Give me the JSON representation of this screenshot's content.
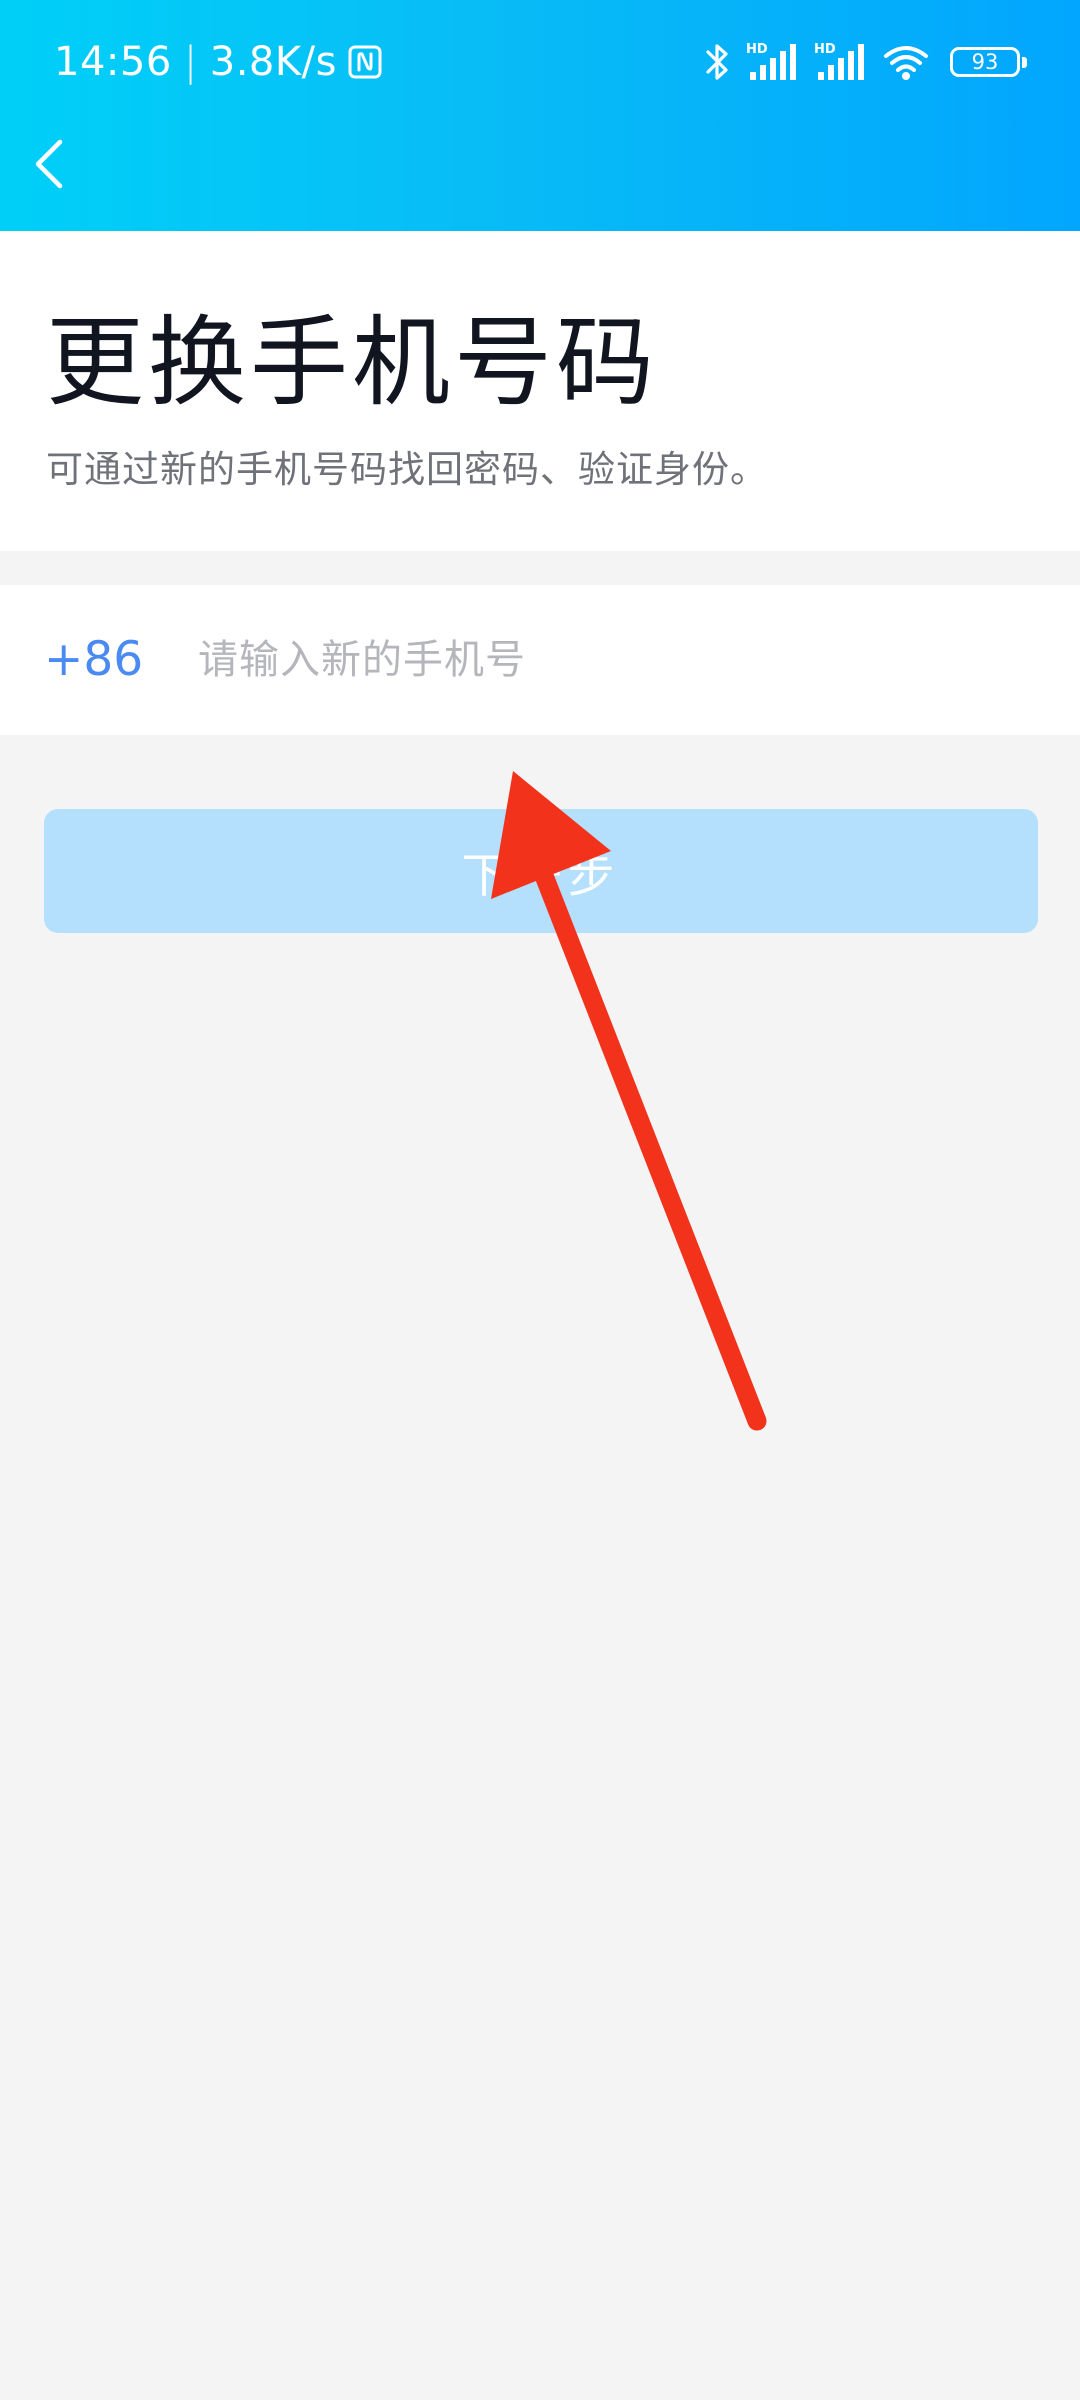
{
  "status_bar": {
    "time": "14:56",
    "separator": "|",
    "net_speed": "3.8K/s",
    "battery_level": "93",
    "icons": [
      "nfc-icon",
      "bluetooth-icon",
      "signal-hd-icon",
      "signal-hd-icon",
      "wifi-icon",
      "battery-icon"
    ]
  },
  "header": {
    "back_icon": "chevron-left-icon"
  },
  "page": {
    "title": "更换手机号码",
    "subtitle": "可通过新的手机号码找回密码、验证身份。"
  },
  "phone_form": {
    "country_code": "+86",
    "placeholder": "请输入新的手机号",
    "value": ""
  },
  "next_button": {
    "label": "下一步"
  },
  "colors": {
    "header_gradient_start": "#00d0f8",
    "header_gradient_end": "#02a6fe",
    "accent_blue": "#4b8af2",
    "button_disabled": "#b4e0fd",
    "annotation_arrow": "#f2321b"
  }
}
